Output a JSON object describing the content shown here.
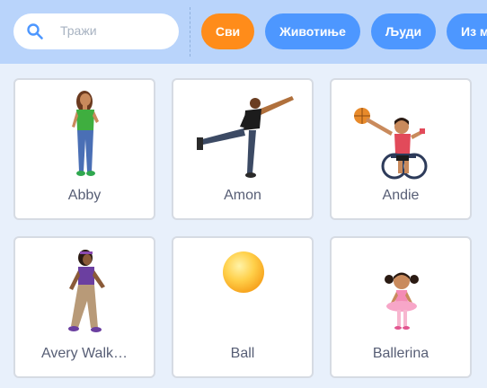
{
  "search": {
    "placeholder": "Тражи",
    "icon": "search-icon"
  },
  "filters": [
    {
      "label": "Сви",
      "active": true
    },
    {
      "label": "Животиње",
      "active": false
    },
    {
      "label": "Људи",
      "active": false
    },
    {
      "label": "Из м",
      "active": false
    }
  ],
  "colors": {
    "accent_active": "#ff8c1a",
    "chip": "#4d97ff",
    "topbar": "#b9d4fb",
    "background": "#e8f0fb",
    "label_text": "#575e75"
  },
  "sprites": [
    {
      "name": "Abby",
      "icon": "girl-standing-icon"
    },
    {
      "name": "Amon",
      "icon": "man-balancing-icon"
    },
    {
      "name": "Andie",
      "icon": "wheelchair-basketball-player-icon"
    },
    {
      "name": "Avery Walk…",
      "icon": "girl-walking-icon"
    },
    {
      "name": "Ball",
      "icon": "ball-icon"
    },
    {
      "name": "Ballerina",
      "icon": "ballerina-icon"
    }
  ]
}
